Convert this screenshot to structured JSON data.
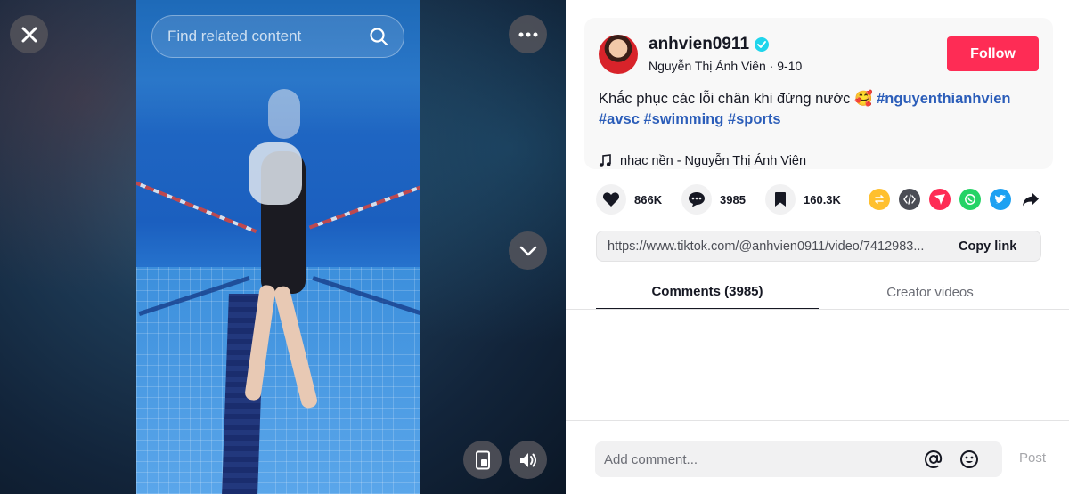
{
  "video": {
    "search_placeholder": "Find related content"
  },
  "icons": {
    "close": "close-icon",
    "search": "search-icon",
    "more": "more-horizontal-icon",
    "down": "chevron-down-icon",
    "mini_player": "mini-player-icon",
    "volume": "volume-icon"
  },
  "author": {
    "username": "anhvien0911",
    "nickname": "Nguyễn Thị Ánh Viên",
    "date": "9-10",
    "separator": " · ",
    "follow_label": "Follow"
  },
  "caption": {
    "text": "Khắc phục các lỗi chân khi đứng nước 🥰",
    "hashtags": [
      "#nguyenthianhvien",
      "#avsc",
      "#swimming",
      "#sports"
    ]
  },
  "music": {
    "label": "nhạc nền - Nguyễn Thị Ánh Viên"
  },
  "actions": {
    "likes": "866K",
    "comments": "3985",
    "saves": "160.3K"
  },
  "link": {
    "url": "https://www.tiktok.com/@anhvien0911/video/7412983...",
    "copy_label": "Copy link"
  },
  "tabs": {
    "comments": "Comments (3985)",
    "creator": "Creator videos"
  },
  "comment_input": {
    "placeholder": "Add comment...",
    "post_label": "Post"
  },
  "colors": {
    "accent": "#fe2c55",
    "hashtag": "#2b5db9",
    "verified": "#20d5ec"
  }
}
